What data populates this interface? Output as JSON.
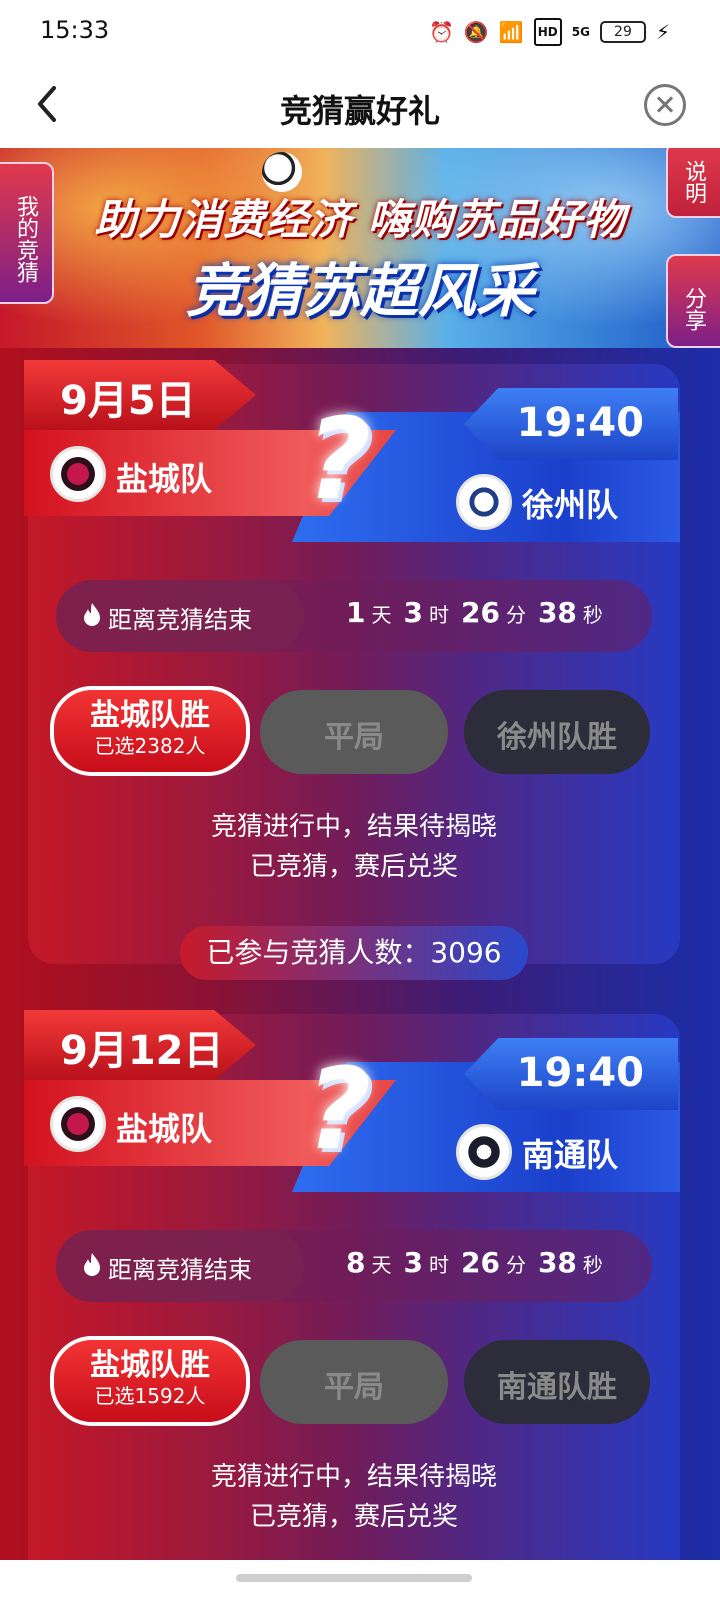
{
  "status_bar": {
    "time": "15:33",
    "network": "5G",
    "hd": "HD",
    "battery": "29"
  },
  "header": {
    "title": "竞猜赢好礼"
  },
  "banner": {
    "line1": "助力消费经济 嗨购苏品好物",
    "line2": "竞猜苏超风采"
  },
  "side_tabs": {
    "my_guess": "我的竞猜",
    "rules": "说明",
    "share": "分享"
  },
  "matches": [
    {
      "date": "9月5日",
      "time": "19:40",
      "home_team": "盐城队",
      "away_team": "徐州队",
      "countdown_label": "距离竞猜结束",
      "countdown": {
        "days": "1",
        "hours": "3",
        "minutes": "26",
        "seconds": "38"
      },
      "units": {
        "d": "天",
        "h": "时",
        "m": "分",
        "s": "秒"
      },
      "options": {
        "home_win": "盐城队胜",
        "home_selected": "已选2382人",
        "draw": "平局",
        "away_win": "徐州队胜"
      },
      "status_line1": "竞猜进行中，结果待揭晓",
      "status_line2": "已竞猜，赛后兑奖",
      "participants": "已参与竞猜人数：3096"
    },
    {
      "date": "9月12日",
      "time": "19:40",
      "home_team": "盐城队",
      "away_team": "南通队",
      "countdown_label": "距离竞猜结束",
      "countdown": {
        "days": "8",
        "hours": "3",
        "minutes": "26",
        "seconds": "38"
      },
      "units": {
        "d": "天",
        "h": "时",
        "m": "分",
        "s": "秒"
      },
      "options": {
        "home_win": "盐城队胜",
        "home_selected": "已选1592人",
        "draw": "平局",
        "away_win": "南通队胜"
      },
      "status_line1": "竞猜进行中，结果待揭晓",
      "status_line2": "已竞猜，赛后兑奖"
    }
  ],
  "colors": {
    "home_red": "#d3121f",
    "away_blue": "#1b3fcb",
    "accent_red": "#c80d1a"
  }
}
